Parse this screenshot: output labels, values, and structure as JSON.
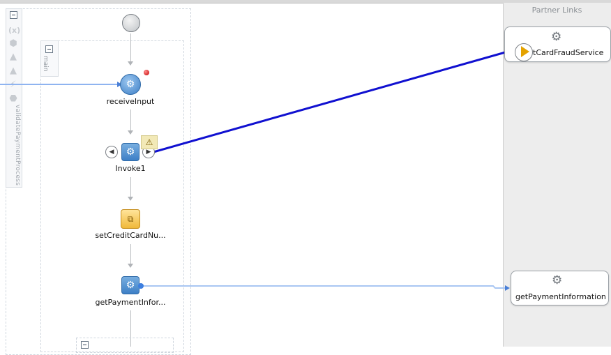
{
  "partner_panel": {
    "title": "Partner Links",
    "links": [
      {
        "label": "tCardFraudService",
        "icon": "gear-icon",
        "role_icon": "play-arrow-icon"
      },
      {
        "label": "getPaymentInformation",
        "icon": "gear-icon"
      }
    ]
  },
  "scopes": {
    "outer_label": "validatePaymentProcess",
    "main_label": "main"
  },
  "activities": {
    "receive": {
      "label": "receiveInput",
      "icon": "gear-icon"
    },
    "invoke": {
      "label": "Invoke1",
      "icon": "gear-icon",
      "warning_icon": "warning-icon"
    },
    "assign": {
      "label": "setCreditCardNu...",
      "icon": "assign-icon"
    },
    "invoke2": {
      "label": "getPaymentInfor...",
      "icon": "gear-icon"
    }
  },
  "colors": {
    "wire_active": "#1010d0",
    "wire_light": "#8fb4f0",
    "panel_bg": "#ededed"
  }
}
